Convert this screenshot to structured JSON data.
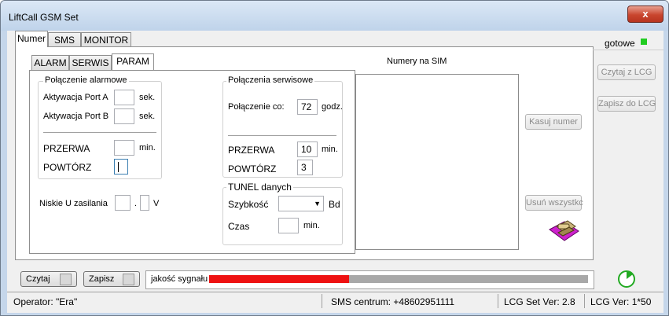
{
  "window": {
    "title": "LiftCall GSM Set",
    "close_label": "x"
  },
  "main_tabs": [
    {
      "label": "Numer",
      "active": true
    },
    {
      "label": "SMS",
      "active": false
    },
    {
      "label": "MONITOR",
      "active": false
    }
  ],
  "sub_tabs": [
    {
      "label": "ALARM",
      "active": false
    },
    {
      "label": "SERWIS",
      "active": false
    },
    {
      "label": "PARAM",
      "active": true
    }
  ],
  "status_ready": "gotowe",
  "status_ready_color": "#22cc22",
  "alarm_group": {
    "title": "Połączenie alarmowe",
    "port_a_label": "Aktywacja Port A",
    "port_a_value": "",
    "port_a_unit": "sek.",
    "port_b_label": "Aktywacja Port B",
    "port_b_value": "",
    "port_b_unit": "sek.",
    "przerwa_label": "PRZERWA",
    "przerwa_value": "",
    "przerwa_unit": "min.",
    "powtorz_label": "POWTÓRZ",
    "powtorz_value": ""
  },
  "low_voltage": {
    "label": "Niskie U zasilania",
    "int_value": "",
    "dot": ".",
    "frac_value": "",
    "unit": "V"
  },
  "service_group": {
    "title": "Połączenia serwisowe",
    "interval_label": "Połączenie co:",
    "interval_value": "72",
    "interval_unit": "godz.",
    "przerwa_label": "PRZERWA",
    "przerwa_value": "10",
    "przerwa_unit": "min.",
    "powtorz_label": "POWTÓRZ",
    "powtorz_value": "3"
  },
  "tunnel_group": {
    "title": "TUNEL danych",
    "speed_label": "Szybkość",
    "speed_value": "",
    "speed_unit": "Bd",
    "time_label": "Czas",
    "time_value": "",
    "time_unit": "min."
  },
  "sim": {
    "title": "Numery na SIM",
    "items": []
  },
  "buttons": {
    "kasuj_numer": "Kasuj numer",
    "usun_wszystko": "Usuń wszystkc",
    "czytaj_z_lcg": "Czytaj z LCG",
    "zapisz_do_lcg": "Zapisz do LCG",
    "czytaj": "Czytaj",
    "zapisz": "Zapisz"
  },
  "signal": {
    "label": "jakość sygnału",
    "level": 0.37,
    "fill_color": "#ee1111",
    "track_color": "#a8a8a8"
  },
  "status_bar": {
    "operator": "Operator: \"Era\"",
    "sms_center": "SMS centrum: +48602951111",
    "lcg_set_ver": "LCG Set Ver: 2.8",
    "lcg_ver": "LCG Ver: 1*50"
  }
}
